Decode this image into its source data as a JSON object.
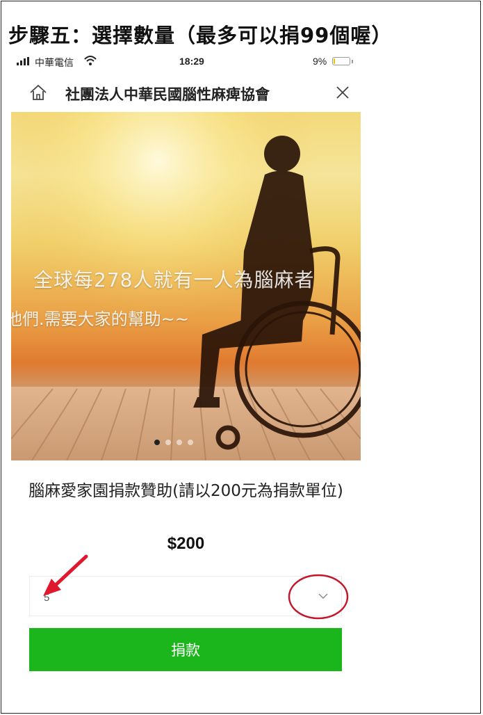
{
  "step_title": "步驟五：選擇數量（最多可以捐99個喔）",
  "status_bar": {
    "carrier": "中華電信",
    "time": "18:29",
    "battery_percent": "9%",
    "battery_level": 0.09,
    "icons": [
      "signal-icon",
      "wifi-icon",
      "battery-icon"
    ]
  },
  "nav": {
    "title": "社團法人中華民國腦性麻痺協會",
    "icons": [
      "home-icon",
      "close-icon"
    ]
  },
  "hero": {
    "line1": "全球每278人就有一人為腦麻者",
    "line2": "他們.需要大家的幫助~~",
    "slide_count": 4,
    "active_slide": 1
  },
  "product": {
    "name": "腦麻愛家園捐款贊助(請以200元為捐款單位)",
    "price": "$200"
  },
  "quantity": {
    "selected": "5",
    "icon": "chevron-down-icon"
  },
  "donate_button": {
    "label": "捐款"
  },
  "colors": {
    "accent_green": "#1bb61b",
    "annotation_red": "#e0182d",
    "battery_yellow": "#f2c300"
  }
}
